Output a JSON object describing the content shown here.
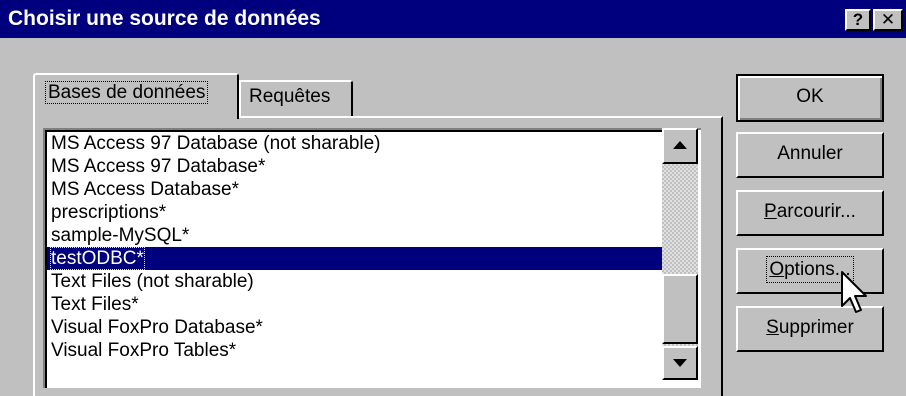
{
  "window": {
    "title": "Choisir une source de données",
    "help_label": "?",
    "close_label": "✕"
  },
  "tabs": [
    {
      "label": "Bases de données",
      "active": true
    },
    {
      "label": "Requêtes",
      "active": false
    }
  ],
  "list": {
    "items": [
      "MS Access 97 Database (not sharable)",
      "MS Access 97 Database*",
      "MS Access Database*",
      "prescriptions*",
      "sample-MySQL*",
      "testODBC*",
      "Text Files (not sharable)",
      "Text Files*",
      "Visual FoxPro Database*",
      "Visual FoxPro Tables*"
    ],
    "selected_index": 5
  },
  "buttons": {
    "ok": "OK",
    "cancel": "Annuler",
    "browse_accel": "P",
    "browse_rest": "arcourir...",
    "options_accel": "O",
    "options_rest": "ptions...",
    "delete_accel": "S",
    "delete_rest": "upprimer"
  }
}
